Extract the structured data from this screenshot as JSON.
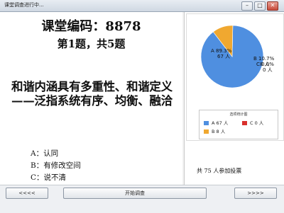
{
  "window": {
    "title": "课堂调查进行中...",
    "minimize": "–",
    "maximize": "□",
    "close": "✕"
  },
  "question": {
    "course_code": "课堂编码：8878",
    "progress": "第1题，共5题",
    "text": "和谐内涵具有多重性、和谐定义——泛指系统有序、均衡、融洽",
    "options": [
      "A：认同",
      "B：有修改空间",
      "C：说不清"
    ]
  },
  "chart_data": {
    "type": "pie",
    "slices": [
      {
        "label": "A",
        "percent": 89.3,
        "count_label": "67 人",
        "color": "#4f8fe0"
      },
      {
        "label": "B",
        "percent": 10.7,
        "count_label": "8 人",
        "color": "#f0a830"
      },
      {
        "label": "C",
        "percent": 0.0,
        "count_label": "0 人",
        "color": "#d9302c"
      }
    ],
    "legend_title": "选项统计图",
    "legend": [
      {
        "text": "A  67 人",
        "color": "#4f8fe0"
      },
      {
        "text": "C  0 人",
        "color": "#d9302c"
      },
      {
        "text": "B  8 人",
        "color": "#f0a830"
      }
    ]
  },
  "stats": {
    "total_text": "共 75 人参加投票"
  },
  "nav": {
    "prev_label": "<<<<",
    "start_label": "开始调查",
    "next_label": ">>>>"
  }
}
